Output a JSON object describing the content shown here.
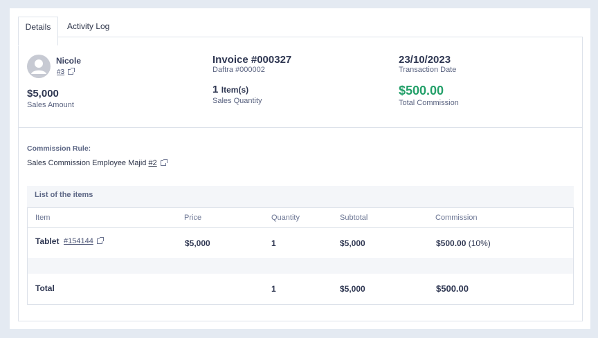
{
  "tabs": [
    {
      "label": "Details"
    },
    {
      "label": "Activity Log"
    }
  ],
  "employee": {
    "name": "Nicole",
    "link": "#3"
  },
  "sales": {
    "amount": "$5,000",
    "amount_label": "Sales Amount"
  },
  "invoice": {
    "title": "Invoice #000327",
    "subtitle": "Daftra #000002",
    "quantity": "1",
    "quantity_unit": "Item(s)",
    "quantity_label": "Sales Quantity"
  },
  "transaction": {
    "date": "23/10/2023",
    "date_label": "Transaction Date",
    "commission": "$500.00",
    "commission_label": "Total Commission"
  },
  "commission_rule": {
    "label": "Commission Rule:",
    "text": "Sales Commission Employee Majid",
    "link": "#2"
  },
  "items_list": {
    "title": "List of the items",
    "columns": [
      "Item",
      "Price",
      "Quantity",
      "Subtotal",
      "Commission"
    ],
    "rows": [
      {
        "item": "Tablet",
        "item_link": "#154144",
        "price": "$5,000",
        "quantity": "1",
        "subtotal": "$5,000",
        "commission": "$500.00",
        "commission_pct": "(10%)"
      }
    ],
    "total": {
      "label": "Total",
      "quantity": "1",
      "subtotal": "$5,000",
      "commission": "$500.00"
    }
  },
  "colors": {
    "accent_green": "#24a06a",
    "background": "#e4eaf2"
  }
}
